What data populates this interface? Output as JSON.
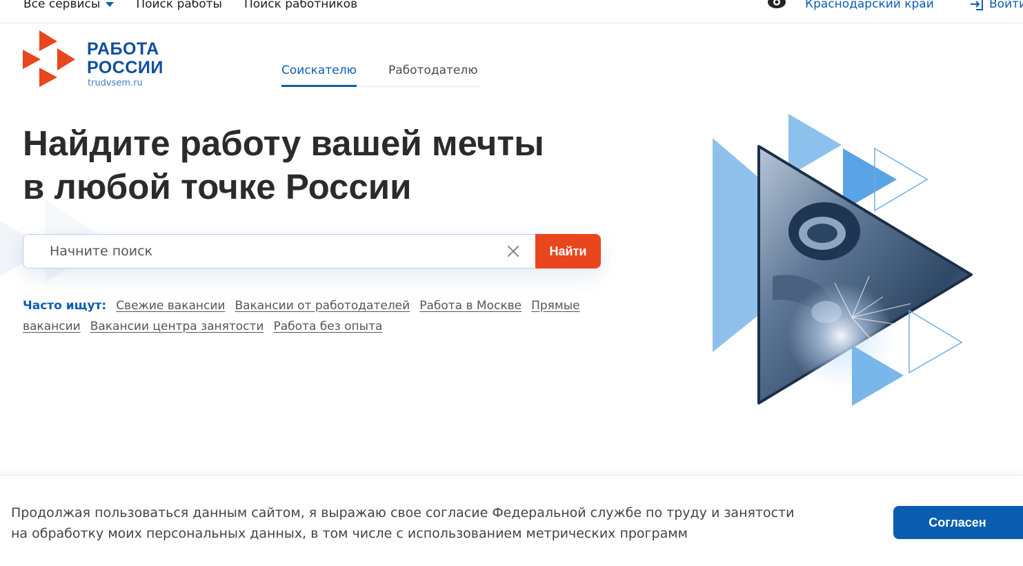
{
  "topbar": {
    "nav": [
      {
        "label": "Все сервисы"
      },
      {
        "label": "Поиск работы"
      },
      {
        "label": "Поиск работников"
      }
    ],
    "region": "Краснодарский край",
    "login": "Войти"
  },
  "logo": {
    "line1": "РАБОТА",
    "line2": "РОССИИ",
    "domain": "trudvsem.ru"
  },
  "tabs": [
    {
      "label": "Соискателю",
      "active": true
    },
    {
      "label": "Работодателю",
      "active": false
    }
  ],
  "hero": {
    "title_line1": "Найдите работу вашей мечты",
    "title_line2": "в любой точке России"
  },
  "search": {
    "placeholder": "Начните поиск",
    "button": "Найти"
  },
  "popular": {
    "label": "Часто ищут:",
    "links": [
      "Свежие вакансии",
      "Вакансии от работодателей",
      "Работа в Москве",
      "Прямые вакансии",
      "Вакансии центра занятости",
      "Работа без опыта"
    ]
  },
  "cookie": {
    "text_line1": "Продолжая пользоваться данным сайтом, я выражаю свое согласие Федеральной службе по труду и занятости",
    "text_line2": "на обработку моих персональных данных, в том числе с использованием метрических программ",
    "button": "Согласен"
  },
  "colors": {
    "brand_blue": "#0b5db0",
    "accent_orange": "#e8461e",
    "light_blue": "#7fb6e8"
  }
}
